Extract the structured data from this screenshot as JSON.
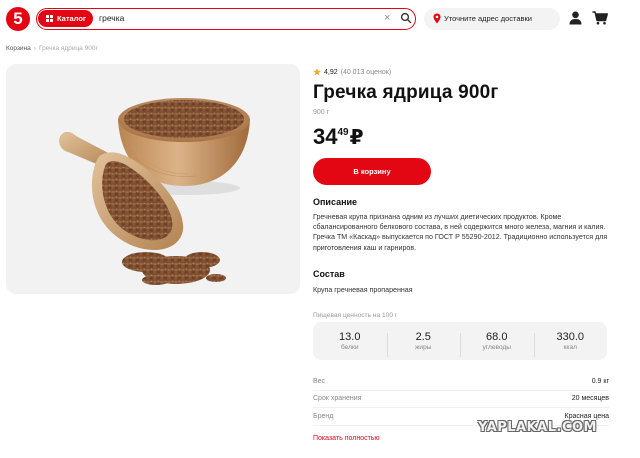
{
  "header": {
    "logo_text": "5",
    "catalog_label": "Каталог",
    "search_value": "гречка",
    "clear_icon": "×",
    "address_label": "Уточните адрес доставки"
  },
  "breadcrumb": {
    "items": [
      "Корзина",
      "Гречка ядрица 900г"
    ]
  },
  "product": {
    "rating": "4,92",
    "rating_count": "(40 013 оценок)",
    "title": "Гречка ядрица 900г",
    "weight": "900 г",
    "price_int": "34",
    "price_dec": "49",
    "currency": "₽",
    "add_to_cart_label": "В корзину",
    "description_title": "Описание",
    "description": "Гречневая крупа признана одним из лучших диетических продуктов. Кроме сбалансированного белкового состава, в ней содержится много железа, магния и калия. Гречка ТМ «Каскад» выпускается по ГОСТ Р 55290-2012. Традиционно используется для приготовления каш и гарниров.",
    "composition_title": "Состав",
    "composition": "Крупа гречневая пропаренная",
    "nutrition_label": "Пищевая ценность на 100 г",
    "nutrition": [
      {
        "value": "13.0",
        "name": "белки"
      },
      {
        "value": "2.5",
        "name": "жиры"
      },
      {
        "value": "68.0",
        "name": "углеводы"
      },
      {
        "value": "330.0",
        "name": "ккал"
      }
    ],
    "properties": [
      {
        "key": "Вес",
        "value": "0.9 кг"
      },
      {
        "key": "Срок хранения",
        "value": "20 месяцев"
      },
      {
        "key": "Бренд",
        "value": "Красная цена"
      }
    ],
    "show_all_label": "Показать полностью"
  },
  "watermark": "YAPLAKAL.COM",
  "colors": {
    "accent": "#e30613",
    "panel": "#f2f2f2",
    "buckwheat": "#8a5a3a",
    "wood": "#c89868"
  },
  "icons": [
    "catalog-grid-icon",
    "clear-icon",
    "search-icon",
    "location-pin-icon",
    "user-icon",
    "cart-icon",
    "star-icon"
  ]
}
